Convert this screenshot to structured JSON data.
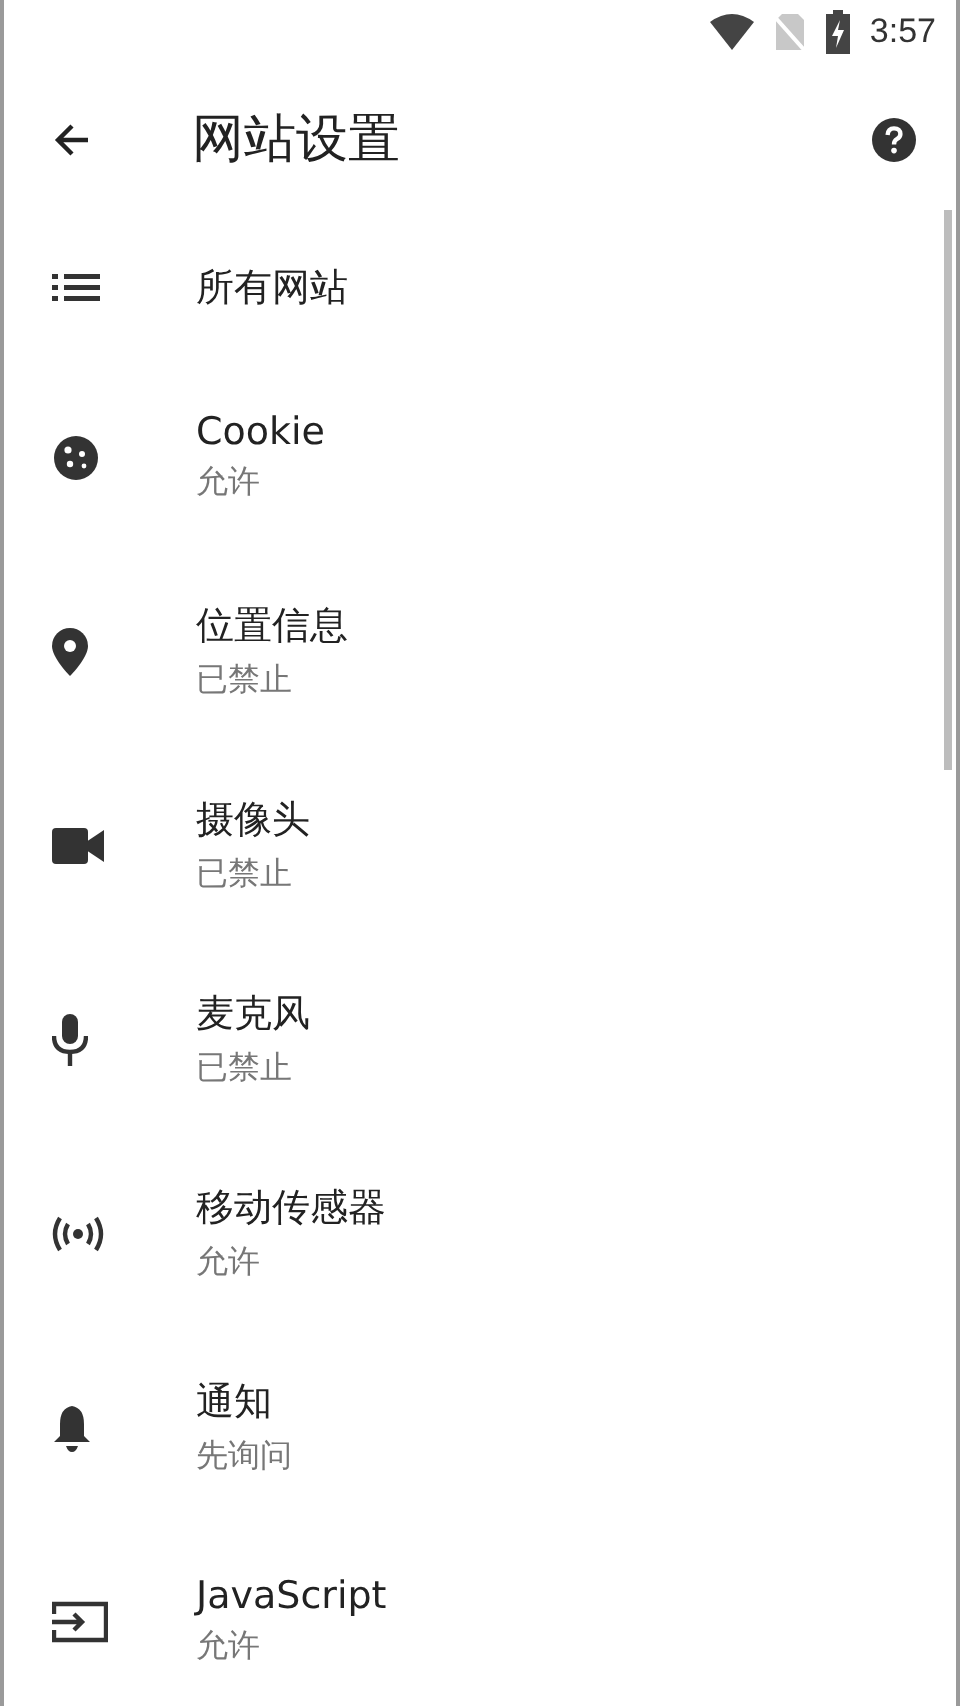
{
  "status_bar": {
    "time": "3:57"
  },
  "toolbar": {
    "title": "网站设置"
  },
  "items": [
    {
      "kind": "list",
      "title": "所有网站"
    },
    {
      "kind": "cookie",
      "title": "Cookie",
      "summary": "允许"
    },
    {
      "kind": "location",
      "title": "位置信息",
      "summary": "已禁止"
    },
    {
      "kind": "camera",
      "title": "摄像头",
      "summary": "已禁止"
    },
    {
      "kind": "mic",
      "title": "麦克风",
      "summary": "已禁止"
    },
    {
      "kind": "sensor",
      "title": "移动传感器",
      "summary": "允许"
    },
    {
      "kind": "bell",
      "title": "通知",
      "summary": "先询问"
    },
    {
      "kind": "script",
      "title": "JavaScript",
      "summary": "允许"
    }
  ]
}
